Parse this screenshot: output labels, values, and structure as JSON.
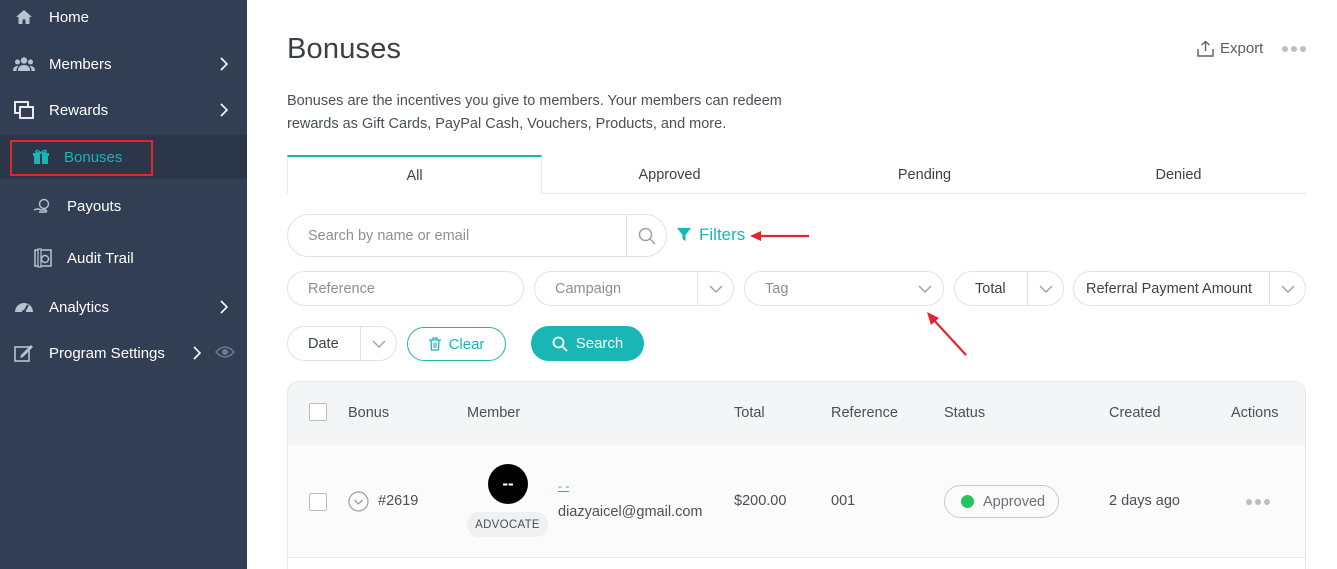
{
  "sidebar": {
    "items": [
      {
        "label": "Home",
        "icon": "home-icon"
      },
      {
        "label": "Members",
        "icon": "members-icon"
      },
      {
        "label": "Rewards",
        "icon": "rewards-icon"
      },
      {
        "label": "Bonuses",
        "icon": "gift-icon"
      },
      {
        "label": "Payouts",
        "icon": "payouts-icon"
      },
      {
        "label": "Audit Trail",
        "icon": "audit-trail-icon"
      },
      {
        "label": "Analytics",
        "icon": "analytics-icon"
      },
      {
        "label": "Program Settings",
        "icon": "settings-icon"
      }
    ]
  },
  "header": {
    "title": "Bonuses",
    "export_label": "Export",
    "description": "Bonuses are the incentives you give to members. Your members can redeem rewards as Gift Cards, PayPal Cash, Vouchers, Products, and more."
  },
  "tabs": [
    {
      "label": "All"
    },
    {
      "label": "Approved"
    },
    {
      "label": "Pending"
    },
    {
      "label": "Denied"
    }
  ],
  "search": {
    "placeholder": "Search by name or email",
    "filters_label": "Filters"
  },
  "filters": {
    "reference_placeholder": "Reference",
    "campaign_placeholder": "Campaign",
    "tag_placeholder": "Tag",
    "total_label": "Total",
    "referral_label": "Referral Payment Amount",
    "date_label": "Date",
    "clear_label": "Clear",
    "search_label": "Search"
  },
  "table": {
    "columns": [
      "Bonus",
      "Member",
      "Total",
      "Reference",
      "Status",
      "Created",
      "Actions"
    ],
    "rows": [
      {
        "bonus_id": "#2619",
        "avatar_text": "--",
        "member_name": "- -",
        "member_role": "ADVOCATE",
        "member_email": "diazyaicel@gmail.com",
        "total": "$200.00",
        "reference": "001",
        "status": "Approved",
        "created": "2 days ago"
      }
    ]
  },
  "colors": {
    "accent": "#1ab5b5",
    "sidebar_bg": "#323e54",
    "status_approved": "#22c55e",
    "annotation": "#e3262e"
  }
}
